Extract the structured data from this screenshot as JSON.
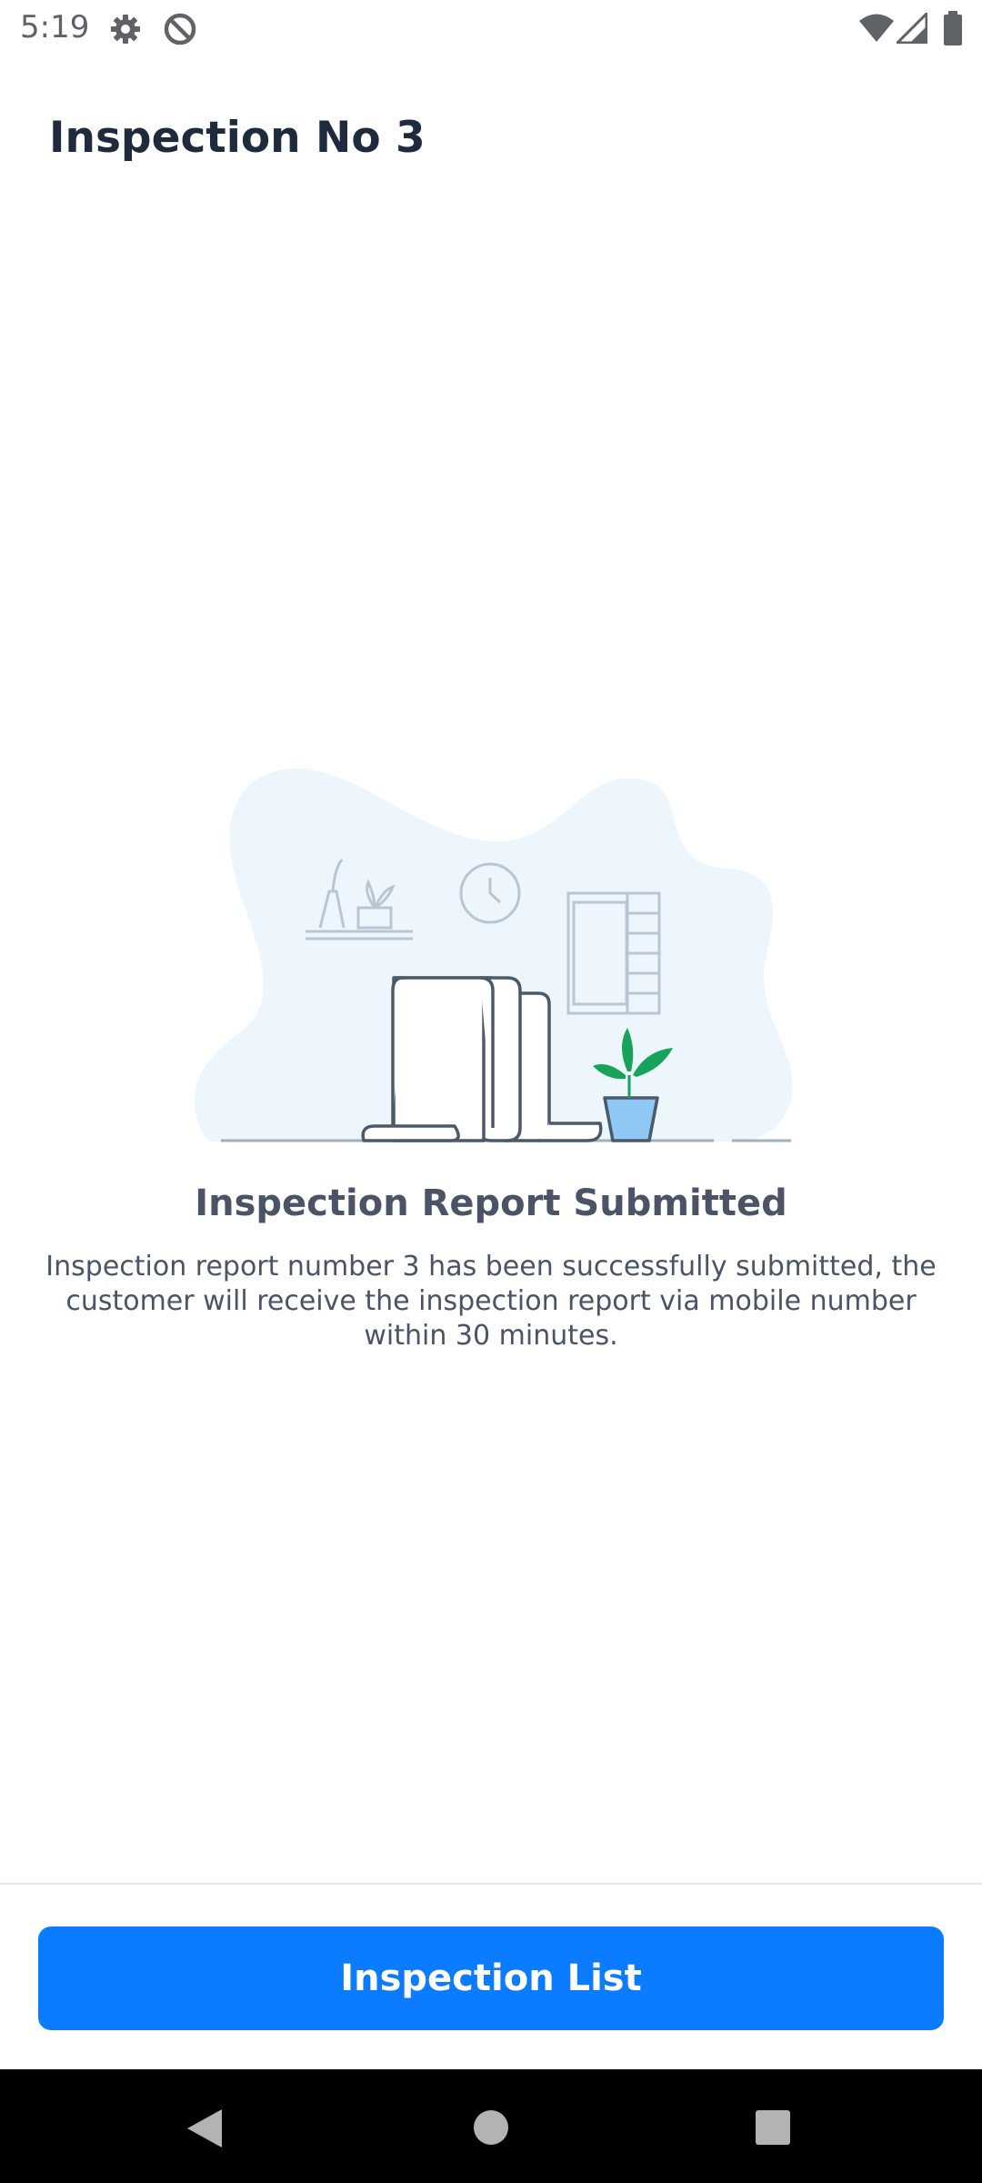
{
  "status_bar": {
    "time": "5:19",
    "left_icons": [
      "gear-icon",
      "do-not-disturb-icon"
    ],
    "right_icons": [
      "wifi-icon",
      "signal-icon",
      "battery-icon"
    ]
  },
  "header": {
    "title": "Inspection No 3"
  },
  "main": {
    "illustration": "empty-room-illustration",
    "result_title": "Inspection Report Submitted",
    "result_message": "Inspection report number 3 has been successfully submitted, the customer will receive the inspection report via mobile number within 30 minutes."
  },
  "footer": {
    "button_label": "Inspection List"
  },
  "colors": {
    "accent": "#0b7cff",
    "title_text": "#1f2a3d",
    "body_text": "#4a5466",
    "illustration_bg": "#eef6fd",
    "plant_green": "#17a35a",
    "pot_blue": "#8fc7f5"
  },
  "nav_bar": {
    "buttons": [
      "back-icon",
      "home-icon",
      "recents-icon"
    ]
  }
}
